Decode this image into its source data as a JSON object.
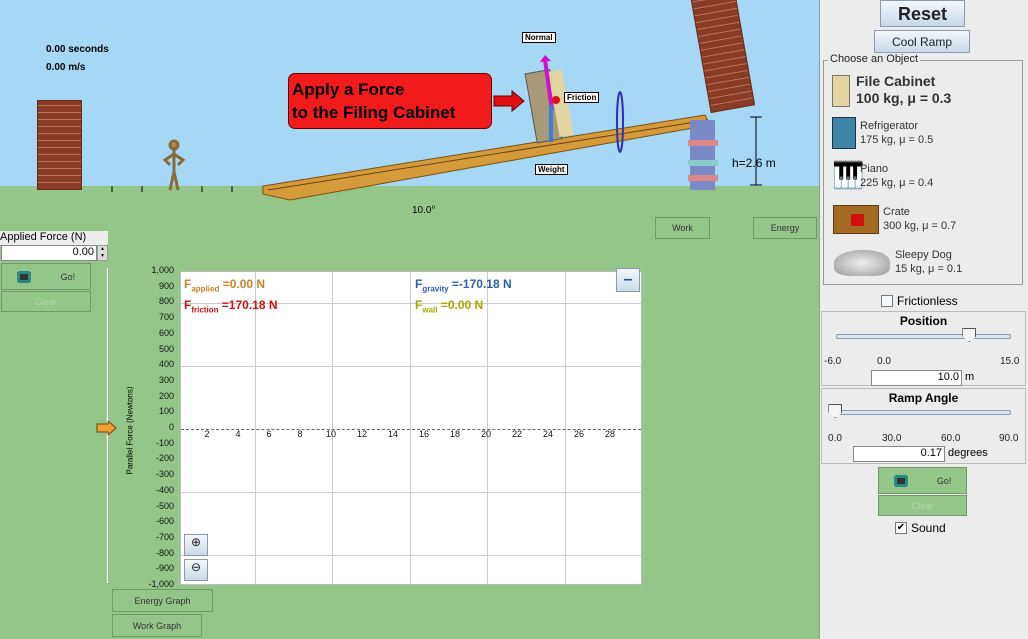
{
  "scene": {
    "time": "0.00 seconds",
    "velocity": "0.00 m/s",
    "callout": [
      "Apply a Force",
      "to the Filing Cabinet"
    ],
    "force_labels": {
      "normal": "Normal",
      "friction": "Friction",
      "weight": "Weight"
    },
    "angle_label": "10.0°",
    "height_label": "h=2.6 m",
    "work_button": "Work",
    "energy_button": "Energy"
  },
  "applied_force": {
    "label": "Applied Force (N)",
    "value": "0.00",
    "go": "Go!",
    "clear": "Clear"
  },
  "graph": {
    "y_label": "Parallel Force (Newtons)",
    "y_ticks": [
      "1,000",
      "900",
      "800",
      "700",
      "600",
      "500",
      "400",
      "300",
      "200",
      "100",
      "0",
      "-100",
      "-200",
      "-300",
      "-400",
      "-500",
      "-600",
      "-700",
      "-800",
      "-900",
      "-1,000"
    ],
    "x_ticks": [
      "2",
      "4",
      "6",
      "8",
      "10",
      "12",
      "14",
      "16",
      "18",
      "20",
      "22",
      "24",
      "26",
      "28"
    ],
    "readouts": {
      "applied": {
        "sub": "applied",
        "value": "=0.00 N",
        "color": "#c8822a"
      },
      "friction": {
        "sub": "friction",
        "value": "=170.18 N",
        "color": "#cc1111"
      },
      "gravity": {
        "sub": "gravity",
        "value": "=-170.18 N",
        "color": "#2a5fb0"
      },
      "wall": {
        "sub": "wall",
        "value": "=0.00 N",
        "color": "#a8a800"
      }
    },
    "minimize": "–",
    "energy_graph": "Energy Graph",
    "work_graph": "Work Graph"
  },
  "panel": {
    "reset": "Reset",
    "cool_ramp": "Cool Ramp",
    "choose_title": "Choose an Object",
    "objects": [
      {
        "name": "File Cabinet",
        "info": "100 kg, μ = 0.3",
        "selected": true
      },
      {
        "name": "Refrigerator",
        "info": "175 kg, μ = 0.5"
      },
      {
        "name": "Piano",
        "info": "225 kg, μ = 0.4"
      },
      {
        "name": "Crate",
        "info": "300 kg, μ = 0.7"
      },
      {
        "name": "Sleepy Dog",
        "info": "15 kg, μ = 0.1"
      }
    ],
    "frictionless": "Frictionless",
    "position": {
      "title": "Position",
      "min": "-6.0",
      "mid": "0.0",
      "max": "15.0",
      "value": "10.0",
      "unit": "m",
      "fraction": 0.762
    },
    "ramp_angle": {
      "title": "Ramp Angle",
      "t0": "0.0",
      "t1": "30.0",
      "t2": "60.0",
      "t3": "90.0",
      "value": "0.17",
      "unit": "degrees",
      "fraction": 0.002
    },
    "go": "Go!",
    "clear": "Clear",
    "sound": "Sound",
    "sound_checked": true
  }
}
